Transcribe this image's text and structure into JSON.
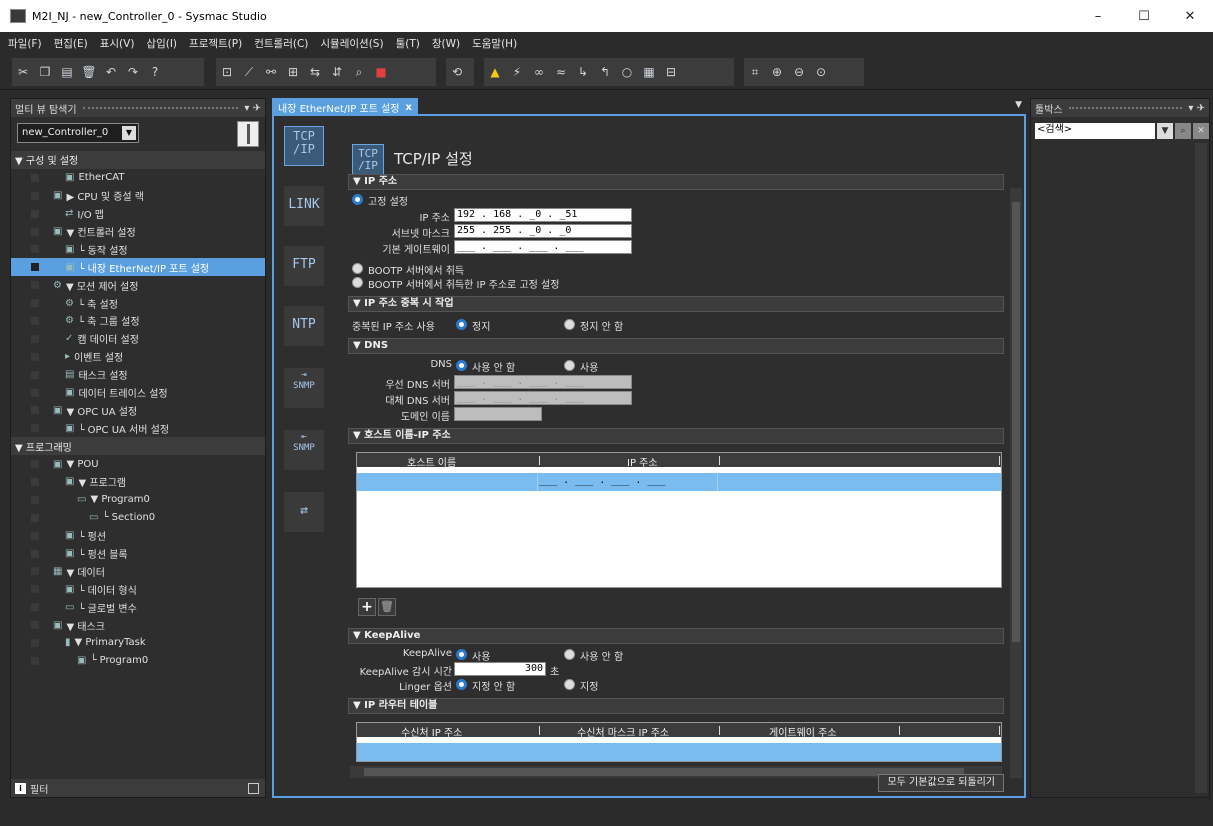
{
  "window": {
    "title": "M2I_NJ - new_Controller_0 - Sysmac Studio",
    "minimize": "–",
    "maximize": "☐",
    "close": "✕"
  },
  "menu": [
    "파일(F)",
    "편집(E)",
    "표시(V)",
    "삽입(I)",
    "프로젝트(P)",
    "컨트롤러(C)",
    "시뮬레이션(S)",
    "툴(T)",
    "창(W)",
    "도움말(H)"
  ],
  "toolbar": {
    "icons": [
      "cut-icon",
      "copy-icon",
      "paste-icon",
      "delete-icon",
      "undo-icon",
      "redo-icon",
      "help-icon",
      "compile-icon",
      "build-icon",
      "online-icon",
      "offline-icon",
      "sync-icon",
      "transfer-icon",
      "monitor-icon",
      "find-icon",
      "stop-icon",
      "reset-icon",
      "warning-icon",
      "force-icon",
      "trace-icon",
      "diff-icon",
      "step-icon",
      "step-out-icon",
      "run-icon",
      "break-icon",
      "watch-icon",
      "fit-icon",
      "zoom-in-icon",
      "zoom-out-icon",
      "zoom-fit-icon"
    ]
  },
  "left": {
    "header": "멀티 뷰 탐색기",
    "pin": "▾ ✈",
    "controller": "new_Controller_0",
    "tree": [
      {
        "label": "▼ 구성 및 설정",
        "indent": 0,
        "hdr": true
      },
      {
        "label": "EtherCAT",
        "indent": 3,
        "icon": "▣"
      },
      {
        "label": "▶ CPU 및 증설 랙",
        "indent": 2,
        "icon": "▣"
      },
      {
        "label": "I/O 맵",
        "indent": 3,
        "icon": "⇄"
      },
      {
        "label": "▼ 컨트롤러 설정",
        "indent": 2,
        "icon": "▣"
      },
      {
        "label": "└ 동작 설정",
        "indent": 3,
        "icon": "▣"
      },
      {
        "label": "└ 내장 EtherNet/IP 포트 설정",
        "indent": 3,
        "icon": "▣",
        "sel": true
      },
      {
        "label": "▼ 모션 제어 설정",
        "indent": 2,
        "icon": "⚙"
      },
      {
        "label": "└ 축 설정",
        "indent": 3,
        "icon": "⚙"
      },
      {
        "label": "└ 축 그룹 설정",
        "indent": 3,
        "icon": "⚙"
      },
      {
        "label": "캠 데이터 설정",
        "indent": 3,
        "icon": "✓"
      },
      {
        "label": "이벤트 설정",
        "indent": 3,
        "icon": "▸"
      },
      {
        "label": "태스크 설정",
        "indent": 3,
        "icon": "▤"
      },
      {
        "label": "데이터 트레이스 설정",
        "indent": 3,
        "icon": "▣"
      },
      {
        "label": "▼ OPC UA 설정",
        "indent": 2,
        "icon": "▣"
      },
      {
        "label": "└ OPC UA 서버 설정",
        "indent": 3,
        "icon": "▣"
      },
      {
        "label": "▼ 프로그래밍",
        "indent": 0,
        "hdr": true
      },
      {
        "label": "▼ POU",
        "indent": 2,
        "icon": "▣"
      },
      {
        "label": "▼ 프로그램",
        "indent": 3,
        "icon": "▣"
      },
      {
        "label": "▼ Program0",
        "indent": 4,
        "icon": "▭"
      },
      {
        "label": "└ Section0",
        "indent": 5,
        "icon": "▭"
      },
      {
        "label": "└ 펑션",
        "indent": 3,
        "icon": "▣"
      },
      {
        "label": "└ 펑션 블록",
        "indent": 3,
        "icon": "▣"
      },
      {
        "label": "▼ 데이터",
        "indent": 2,
        "icon": "▦"
      },
      {
        "label": "└ 데이터 형식",
        "indent": 3,
        "icon": "▣"
      },
      {
        "label": "└ 글로벌 변수",
        "indent": 3,
        "icon": "▭"
      },
      {
        "label": "▼ 태스크",
        "indent": 2,
        "icon": "▣"
      },
      {
        "label": "▼ PrimaryTask",
        "indent": 3,
        "icon": "▮"
      },
      {
        "label": "└ Program0",
        "indent": 4,
        "icon": "▣"
      }
    ],
    "filter": "필터"
  },
  "center": {
    "tab": "내장 EtherNet/IP 포트 설정",
    "tab_close": "x",
    "side_buttons": [
      "TCP/IP",
      "LINK",
      "FTP",
      "NTP",
      "SNMP",
      "SNMP"
    ],
    "page_title": "TCP/IP 설정",
    "sections": {
      "ip": "▼ IP 주소",
      "dup": "▼ IP 주소 중복 시 작업",
      "dns": "▼ DNS",
      "host": "▼ 호스트 이름-IP 주소",
      "keepalive": "▼ KeepAlive",
      "router": "▼ IP 라우터 테이블"
    },
    "ip": {
      "fixed": "고정 설정",
      "ip_label": "IP 주소",
      "ip_value": "192 . 168 . _0 . _51",
      "subnet_label": "서브넷 마스크",
      "subnet_value": "255 . 255 . _0 . _0",
      "gateway_label": "기본 게이트웨이",
      "gateway_value": "___ . ___ . ___ . ___",
      "bootp1": "BOOTP 서버에서 취득",
      "bootp2": "BOOTP 서버에서 취득한 IP 주소로 고정 설정"
    },
    "dup": {
      "label": "중복된 IP 주소 사용",
      "stop": "정지",
      "nostop": "정지 안 함"
    },
    "dns": {
      "label": "DNS",
      "off": "사용 안 함",
      "on": "사용",
      "primary": "우선 DNS 서버",
      "secondary": "대체 DNS 서버",
      "domain": "도메인 이름",
      "blank_ip": "___ . ___ . ___ . ___"
    },
    "host": {
      "col1": "호스트 이름",
      "col2": "IP 주소",
      "row_ip": "___ . ___ . ___ . ___"
    },
    "keepalive": {
      "label": "KeepAlive",
      "on": "사용",
      "off": "사용 안 함",
      "time_label": "KeepAlive 감시 시간",
      "time_value": "300",
      "unit": "초",
      "linger_label": "Linger 옵션",
      "linger_off": "지정 안 함",
      "linger_on": "지정"
    },
    "router": {
      "col1": "수신처 IP 주소",
      "col2": "수신처 마스크 IP 주소",
      "col3": "게이트웨이 주소"
    },
    "reset_btn": "모두 기본값으로 되돌리기"
  },
  "right": {
    "header": "툴박스",
    "search": "<검색>"
  },
  "colors": {
    "accent": "#5aa0e0",
    "selected_row": "#7bbcf0"
  }
}
